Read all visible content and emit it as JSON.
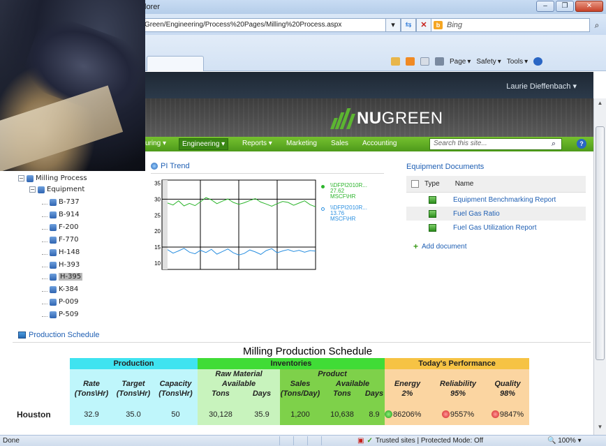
{
  "browser": {
    "title": "lorer",
    "address": "Green/Engineering/Process%20Pages/Milling%20Process.aspx",
    "search_placeholder": "Bing",
    "commands": [
      "Page",
      "Safety",
      "Tools"
    ],
    "window_buttons": [
      "–",
      "❐",
      "✕"
    ]
  },
  "sharepoint": {
    "user": "Laurie Dieffenbach",
    "logo_bold": "NU",
    "logo_rest": "GREEN",
    "nav": [
      "uring",
      "Engineering",
      "Reports",
      "Marketing",
      "Sales",
      "Accounting"
    ],
    "search_placeholder": "Search this site...",
    "help": "?"
  },
  "tree": {
    "root": "Milling Process",
    "group": "Equipment",
    "items": [
      "B-737",
      "B-914",
      "F-200",
      "F-770",
      "H-148",
      "H-393",
      "H-395",
      "K-384",
      "P-009",
      "P-509"
    ],
    "selected": "H-395"
  },
  "pi_trend": {
    "title": "PI Trend",
    "legend": [
      {
        "tag": "\\\\DFPI2010R...",
        "value": "27.62",
        "unit": "MSCF\\HR",
        "color": "#2db52d"
      },
      {
        "tag": "\\\\DFPI2010R...",
        "value": "13.76",
        "unit": "MSCF\\HR",
        "color": "#2a8fe0"
      }
    ],
    "y_ticks": [
      "35",
      "30",
      "25",
      "20",
      "15",
      "10"
    ]
  },
  "chart_data": {
    "type": "line",
    "ylim": [
      8,
      36
    ],
    "series": [
      {
        "name": "\\\\DFPI2010R...",
        "values": [
          28.8,
          28.2,
          29.5,
          27.9,
          28.7,
          28.0,
          29.2,
          30.5,
          29.8,
          28.6,
          29.4,
          30.1,
          29.0,
          28.4,
          28.9,
          29.6,
          30.2,
          29.1,
          28.5,
          27.8,
          28.6,
          29.3,
          29.0,
          28.1,
          28.8,
          29.5,
          28.3,
          27.62
        ]
      },
      {
        "name": "\\\\DFPI2010R...",
        "values": [
          14.2,
          13.1,
          13.8,
          14.6,
          13.4,
          12.9,
          14.0,
          13.3,
          14.3,
          12.8,
          13.6,
          14.4,
          13.2,
          12.5,
          13.0,
          14.1,
          13.5,
          12.7,
          13.9,
          14.5,
          13.2,
          13.8,
          14.2,
          13.6,
          14.0,
          13.4,
          13.9,
          13.76
        ]
      }
    ]
  },
  "docs": {
    "title": "Equipment Documents",
    "col_type": "Type",
    "col_name": "Name",
    "rows": [
      "Equipment Benchmarking Report",
      "Fuel Gas Ratio",
      "Fuel Gas Utilization Report"
    ],
    "add": "Add document"
  },
  "schedule": {
    "section": "Production Schedule",
    "title": "Milling Production Schedule",
    "groups": {
      "production": "Production",
      "inventories": "Inventories",
      "performance": "Today's Performance"
    },
    "sub": {
      "raw": "Raw Material",
      "product": "Product"
    },
    "cols": {
      "rate": "Rate",
      "rate_u": "(Tons\\Hr)",
      "target": "Target",
      "target_u": "(Tons\\Hr)",
      "capacity": "Capacity",
      "capacity_u": "(Tons\\Hr)",
      "raw_avail": "Available",
      "raw_tons": "Tons",
      "raw_days": "Days",
      "sales": "Sales",
      "sales_u": "(Tons/Day)",
      "prod_avail": "Available",
      "prod_tons": "Tons",
      "prod_days": "Days",
      "energy": "Energy",
      "energy_t": "2%",
      "reliability": "Reliability",
      "reliability_t": "95%",
      "quality": "Quality",
      "quality_t": "98%"
    },
    "row": {
      "site": "Houston",
      "rate": "32.9",
      "target": "35.0",
      "capacity": "50",
      "raw_tons": "30,128",
      "raw_days": "35.9",
      "sales": "1,200",
      "prod_tons": "10,638",
      "prod_days": "8.9",
      "energy": "86206%",
      "reliability": "9557%",
      "quality": "9847%"
    }
  },
  "status": {
    "left": "Done",
    "zone": "Trusted sites | Protected Mode: Off",
    "zoom": "100%"
  }
}
